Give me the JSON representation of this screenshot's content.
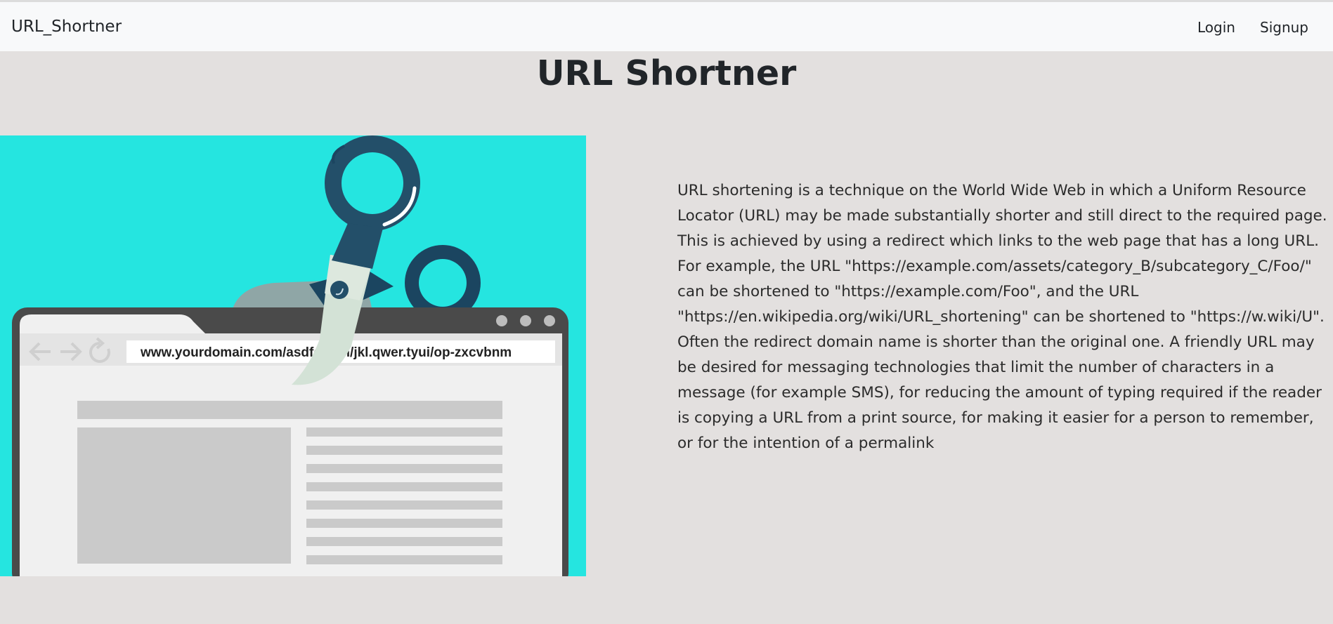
{
  "navbar": {
    "brand": "URL_Shortner",
    "links": [
      {
        "label": "Login"
      },
      {
        "label": "Signup"
      }
    ]
  },
  "main": {
    "title": "URL Shortner",
    "description": "URL shortening is a technique on the World Wide Web in which a Uniform Resource Locator (URL) may be made substantially shorter and still direct to the required page. This is achieved by using a redirect which links to the web page that has a long URL. For example, the URL \"https://example.com/assets/category_B/subcategory_C/Foo/\" can be shortened to \"https://example.com/Foo\", and the URL \"https://en.wikipedia.org/wiki/URL_shortening\" can be shortened to \"https://w.wiki/U\". Often the redirect domain name is shorter than the original one. A friendly URL may be desired for messaging technologies that limit the number of characters in a message (for example SMS), for reducing the amount of typing required if the reader is copying a URL from a print source, for making it easier for a person to remember, or for the intention of a permalink"
  },
  "illustration": {
    "address_bar_text": "www.yourdomain.com/asdfg.hgh/jkl.qwer.tyui/op-zxcvbnm",
    "icons": [
      "back-arrow-icon",
      "forward-arrow-icon",
      "refresh-icon",
      "scissors-icon"
    ],
    "colors": {
      "background": "#25e5e0",
      "scissors_handle": "#234f69",
      "browser_frame": "#4a4a4a"
    }
  }
}
